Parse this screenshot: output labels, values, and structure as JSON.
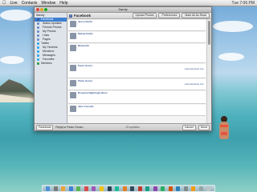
{
  "menubar": {
    "apple": "",
    "items": [
      "Live",
      "Contacts",
      "Window",
      "Help"
    ],
    "right": [
      "Tue 7:06 PM"
    ]
  },
  "window": {
    "title": "Sandy",
    "toolbar": {
      "title": "Facebook",
      "upload_photos": "Upload Photos",
      "preferences": "Preferences",
      "mark_all_as_read": "Mark All As Read"
    },
    "sidebar": {
      "header": "Sandy",
      "items": [
        {
          "label": "Facebook",
          "color": "#3b5998"
        },
        {
          "label": "Status Updates",
          "color": "#6b8fd0"
        },
        {
          "label": "Friends Photos",
          "color": "#6b8fd0"
        },
        {
          "label": "My Photos",
          "color": "#6b8fd0"
        },
        {
          "label": "Links",
          "color": "#6b8fd0"
        },
        {
          "label": "Pages",
          "color": "#6b8fd0"
        },
        {
          "label": "Twitter",
          "color": "#33aaee"
        },
        {
          "label": "My Timeline",
          "color": "#33aaee"
        },
        {
          "label": "Mentions",
          "color": "#33aaee"
        },
        {
          "label": "Messages",
          "color": "#33aaee"
        },
        {
          "label": "Favorites",
          "color": "#33aaee"
        },
        {
          "label": "Netvibes",
          "color": "#2a9d4a"
        }
      ]
    },
    "feed": [
      {
        "name": "Jason Smith",
        "text": "",
        "meta": "",
        "link": ""
      },
      {
        "name": "Mandy Keller",
        "text": "",
        "meta": "",
        "link": ""
      },
      {
        "name": "Bluetooth",
        "text": "",
        "meta": "",
        "link": ""
      },
      {
        "name": "Paolo Gonzo",
        "text": "",
        "meta": "",
        "link": "www.facebook.com"
      },
      {
        "name": "Paolo Gonzo",
        "text": "",
        "meta": "",
        "link": "www.facebook.com"
      },
      {
        "name": "Rosanna Nightingly Rizzo",
        "text": "",
        "meta": "",
        "link": ""
      },
      {
        "name": "Jane Cassells",
        "text": "",
        "meta": "",
        "link": ""
      }
    ],
    "statusbar": {
      "share_label": "Facebook",
      "reply_label": "Reply to Paolo Gonzo",
      "count": "20 updates",
      "cancel": "Cancel",
      "send": "Send"
    }
  },
  "colors": {
    "accent": "#3d80d2",
    "facebook": "#3b5998",
    "swimsuit": "#e2563b"
  }
}
